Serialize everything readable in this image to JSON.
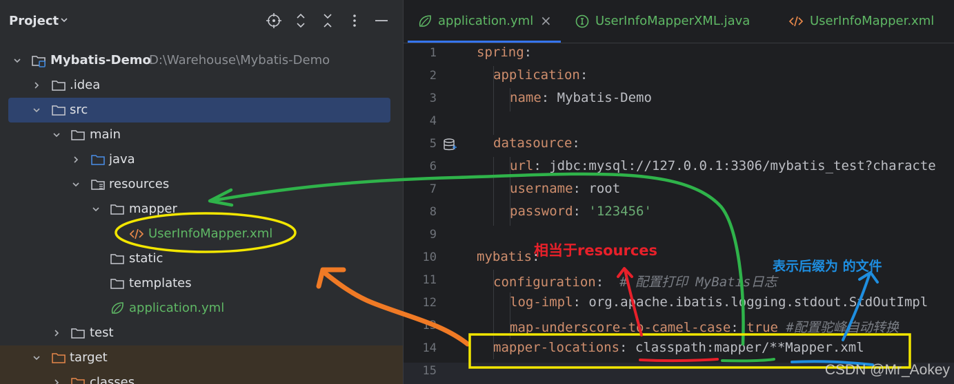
{
  "project_panel": {
    "title": "Project",
    "icons": [
      "locate-icon",
      "expand-all-icon",
      "collapse-all-icon",
      "more-options-icon",
      "hide-icon"
    ],
    "tree": [
      {
        "label": "Mybatis-Demo",
        "path": "D:\\Warehouse\\Mybatis-Demo",
        "icon": "module-icon",
        "expanded": true
      },
      {
        "label": ".idea",
        "icon": "folder-icon",
        "expanded": false
      },
      {
        "label": "src",
        "icon": "folder-icon",
        "expanded": true,
        "selected": true
      },
      {
        "label": "main",
        "icon": "folder-icon",
        "expanded": true
      },
      {
        "label": "java",
        "icon": "source-folder-icon",
        "expanded": false
      },
      {
        "label": "resources",
        "icon": "resources-folder-icon",
        "expanded": true
      },
      {
        "label": "mapper",
        "icon": "folder-icon",
        "expanded": true
      },
      {
        "label": "UserInfoMapper.xml",
        "icon": "xml-file-icon"
      },
      {
        "label": "static",
        "icon": "folder-icon"
      },
      {
        "label": "templates",
        "icon": "folder-icon"
      },
      {
        "label": "application.yml",
        "icon": "spring-config-icon"
      },
      {
        "label": "test",
        "icon": "folder-icon",
        "expanded": false
      },
      {
        "label": "target",
        "icon": "excluded-folder-icon",
        "expanded": true
      },
      {
        "label": "classes",
        "icon": "excluded-folder-icon",
        "expanded": false
      }
    ]
  },
  "editor": {
    "tabs": [
      {
        "label": "application.yml",
        "icon": "spring-config-icon",
        "active": true,
        "close": "×"
      },
      {
        "label": "UserInfoMapperXML.java",
        "icon": "interface-icon"
      },
      {
        "label": "UserInfoMapper.xml",
        "icon": "xml-file-icon"
      }
    ],
    "line_numbers": [
      "1",
      "2",
      "3",
      "4",
      "5",
      "6",
      "7",
      "8",
      "9",
      "10",
      "11",
      "12",
      "13",
      "14",
      "15"
    ],
    "lines": [
      {
        "key": "spring",
        "sep": ":",
        "val": ""
      },
      {
        "key": "application",
        "sep": ":",
        "val": ""
      },
      {
        "key": "name",
        "sep": ": ",
        "val": "Mybatis-Demo"
      },
      {
        "key": "",
        "sep": "",
        "val": ""
      },
      {
        "key": "datasource",
        "sep": ":",
        "val": ""
      },
      {
        "key": "url",
        "sep": ": ",
        "val": "jdbc:mysql://127.0.0.1:3306/mybatis_test?characte"
      },
      {
        "key": "username",
        "sep": ": ",
        "val": "root"
      },
      {
        "key": "password",
        "sep": ": ",
        "val": "'123456'"
      },
      {
        "key": "",
        "sep": "",
        "val": ""
      },
      {
        "key": "mybatis",
        "sep": ":",
        "val": ""
      },
      {
        "key": "configuration",
        "sep": ": ",
        "val": "",
        "comment": "# 配置打印 MyBatis日志"
      },
      {
        "key": "log-impl",
        "sep": ": ",
        "val": "org.apache.ibatis.logging.stdout.StdOutImpl"
      },
      {
        "key": "map-underscore-to-camel-case",
        "sep": ": ",
        "val": "true",
        "comment": "#配置驼峰自动转换"
      },
      {
        "key": "mapper-locations",
        "sep": ": ",
        "val": "classpath:mapper/**Mapper.xml"
      },
      {
        "key": "",
        "sep": "",
        "val": ""
      }
    ],
    "gutter_icon": "database-icon"
  },
  "annotations": {
    "red_note": "相当于resources",
    "blue_note": "表示后缀为  的文件",
    "colors": {
      "red": "#e8202a",
      "blue": "#1e8ee0",
      "green": "#2fb34a",
      "yellow": "#f2e600",
      "orange": "#f07a25"
    }
  },
  "watermark": "CSDN @Mr_Aokey"
}
